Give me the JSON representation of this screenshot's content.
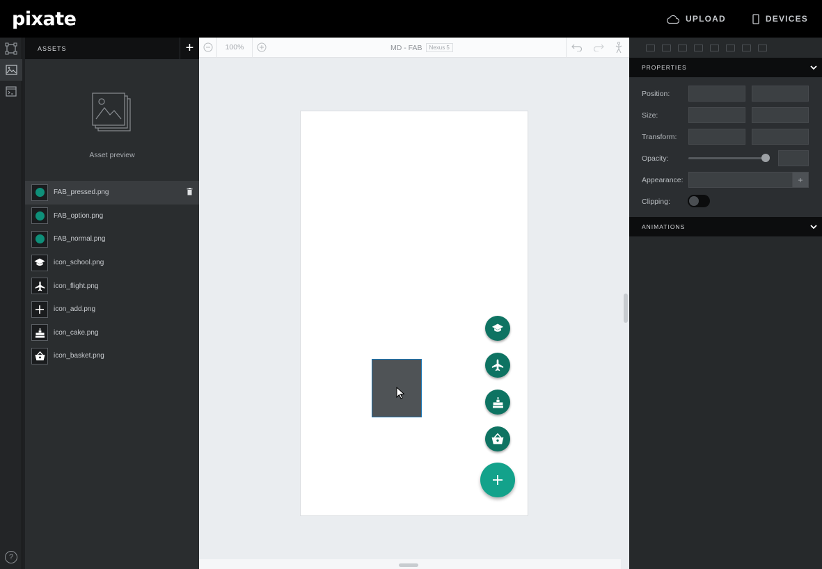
{
  "app": {
    "logo": "pixate",
    "upload_label": "UPLOAD",
    "devices_label": "DEVICES"
  },
  "help": "?",
  "assets": {
    "title": "ASSETS",
    "add": "+",
    "preview_label": "Asset preview",
    "items": [
      {
        "name": "FAB_pressed.png",
        "icon": "teal-circle",
        "selected": true
      },
      {
        "name": "FAB_option.png",
        "icon": "teal-circle"
      },
      {
        "name": "FAB_normal.png",
        "icon": "teal-circle"
      },
      {
        "name": "icon_school.png",
        "icon": "school-icon"
      },
      {
        "name": "icon_flight.png",
        "icon": "flight-icon"
      },
      {
        "name": "icon_add.png",
        "icon": "add-icon"
      },
      {
        "name": "icon_cake.png",
        "icon": "cake-icon"
      },
      {
        "name": "icon_basket.png",
        "icon": "basket-icon"
      }
    ]
  },
  "canvas": {
    "zoom": "100%",
    "title": "MD - FAB",
    "device": "Nexus 5",
    "fab_mini": [
      "school-icon",
      "flight-icon",
      "cake-icon",
      "basket-icon"
    ],
    "fab_main": "+"
  },
  "properties": {
    "title": "PROPERTIES",
    "position_label": "Position:",
    "size_label": "Size:",
    "transform_label": "Transform:",
    "opacity_label": "Opacity:",
    "appearance_label": "Appearance:",
    "clipping_label": "Clipping:",
    "appearance_add": "+"
  },
  "animations": {
    "title": "ANIMATIONS"
  },
  "colors": {
    "accent": "#13a28b",
    "fab_dark": "#0e7362",
    "selection": "#1a76b5"
  }
}
